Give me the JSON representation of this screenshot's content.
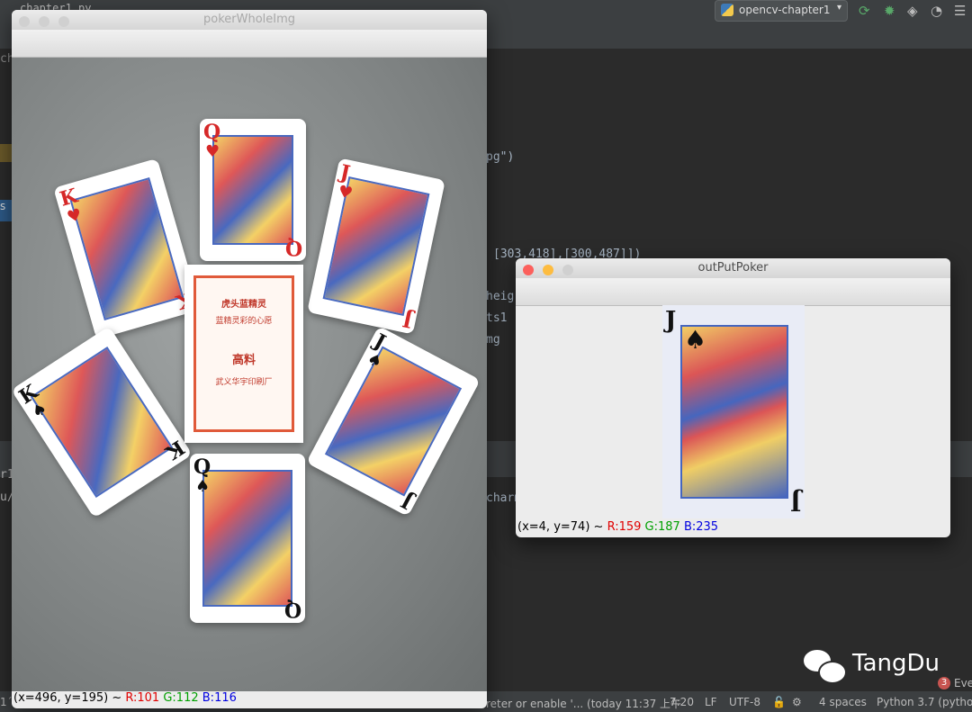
{
  "ide": {
    "file_tab": "chapter1.py",
    "run_config": "opencv-chapter1",
    "code_lines": {
      "l1": "pg\")",
      "l2": "[303,418],[300,487]])",
      "l3": "heig",
      "l4": "ts1",
      "l5": "mg",
      "l6": "charm"
    },
    "side_labels": {
      "chap": "chap",
      "s": "s",
      "r1": "r1",
      "u": "u/",
      "one": "1´"
    },
    "status": {
      "message": "reter or enable '... (today 11:37 上午",
      "position": "7:20",
      "line_sep": "LF",
      "encoding": "UTF-8",
      "indent": "4 spaces",
      "interpreter": "Python 3.7 (python",
      "events_count": "3",
      "events_label": "Eve"
    }
  },
  "windows": {
    "poker_whole": {
      "title": "pokerWholeImg",
      "status": {
        "coords": "(x=496, y=195) ~",
        "r": "R:101",
        "g": "G:112",
        "b": "B:116"
      }
    },
    "output_poker": {
      "title": "outPutPoker",
      "status": {
        "coords": "(x=4, y=74) ~",
        "r": "R:159",
        "g": "G:187",
        "b": "B:235"
      }
    }
  },
  "cards": {
    "k_hearts": {
      "rank": "K",
      "suit": "♥"
    },
    "q_hearts": {
      "rank": "Q",
      "suit": "♥"
    },
    "j_hearts": {
      "rank": "J",
      "suit": "♥"
    },
    "k_spades": {
      "rank": "K",
      "suit": "♠"
    },
    "j_spades": {
      "rank": "J",
      "suit": "♠"
    },
    "q_spades": {
      "rank": "Q",
      "suit": "♠"
    },
    "output_j_spades": {
      "rank": "J",
      "suit": "♠"
    }
  },
  "pack": {
    "line1": "虎头蓝精灵",
    "line2": "蓝精灵彩的心愿",
    "line3": "高料",
    "line4": "武义华宇印刷厂"
  },
  "watermark": {
    "text": "TangDu"
  },
  "colors": {
    "red_channel": "#e00000",
    "green_channel": "#00a000",
    "blue_channel": "#0000e0"
  }
}
